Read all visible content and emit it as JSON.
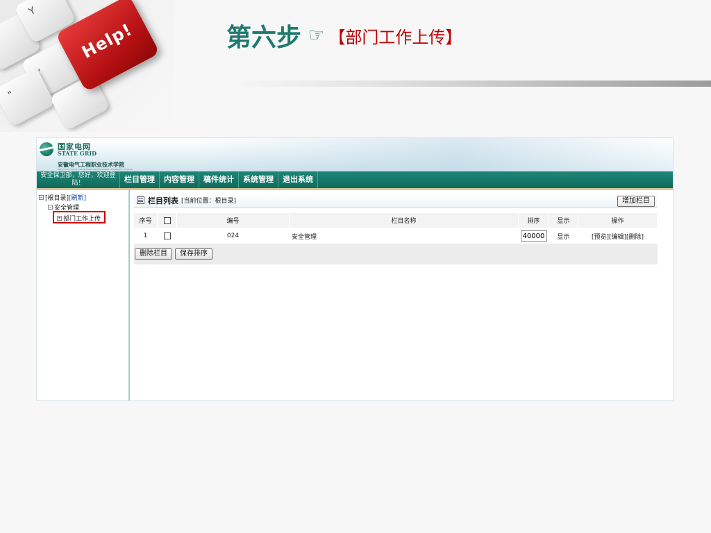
{
  "slide": {
    "help_key_text": "Help!",
    "title_step": "第六步",
    "title_hand": "☞",
    "title_sub": "【部门工作上传】"
  },
  "app": {
    "logo": {
      "cn": "国家电网",
      "en": "STATE GRID",
      "school": "安徽电气工程职业技术学院",
      "school_en": "ANHUI ELECTRICAL ENGINEERING PROFESSIONAL TECHNIQUE COLLEGE"
    },
    "nav": {
      "user_line1": "安全保卫部，您好，欢迎登",
      "user_line2": "陆！",
      "items": [
        "栏目管理",
        "内容管理",
        "稿件统计",
        "系统管理",
        "退出系统"
      ]
    },
    "tree": {
      "root_label": "[根目录]",
      "refresh_label": "[刷新]",
      "level1": "安全管理",
      "level2": "部门工作上传"
    },
    "content": {
      "title": "栏目列表",
      "location": "[当前位置：根目录]",
      "add_button": "增加栏目",
      "columns": [
        "序号",
        "",
        "编号",
        "栏目名称",
        "排序",
        "显示",
        "操作"
      ],
      "rows": [
        {
          "index": "1",
          "code": "024",
          "name": "安全管理",
          "order": "40000",
          "display": "显示",
          "ops": [
            "[预览]",
            "[编辑]",
            "[删除]"
          ]
        }
      ],
      "delete_button": "删除栏目",
      "save_order_button": "保存排序"
    }
  }
}
